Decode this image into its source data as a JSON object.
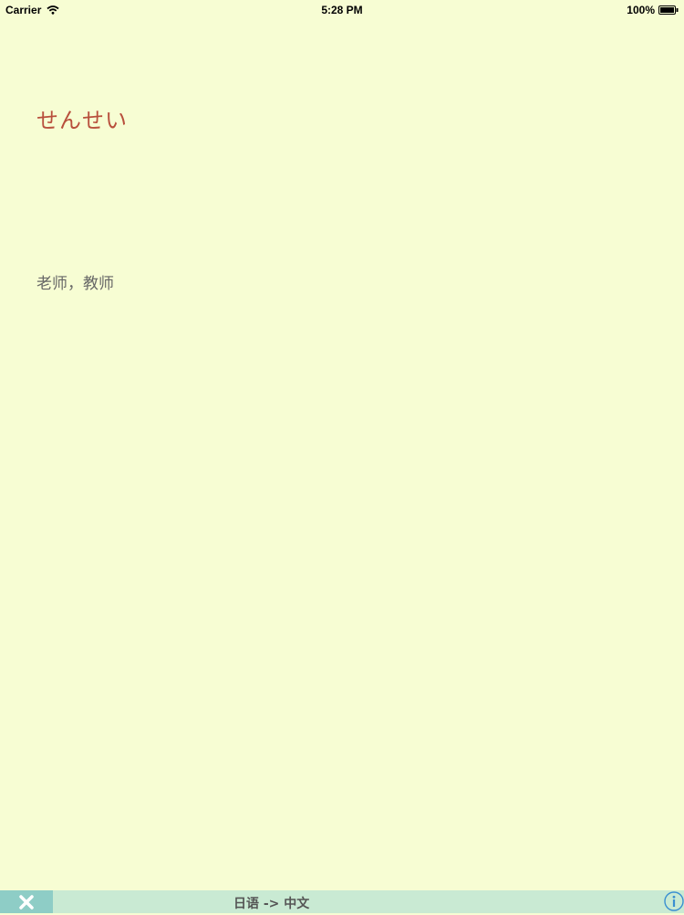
{
  "status_bar": {
    "carrier": "Carrier",
    "time": "5:28 PM",
    "battery": "100%"
  },
  "card": {
    "word": "せんせい",
    "meaning": "老师，教师"
  },
  "bottom_bar": {
    "direction": "日语 -> 中文",
    "close_icon": "close-icon",
    "info_icon": "info-icon"
  },
  "colors": {
    "background": "#f7fdd3",
    "word": "#b84f3c",
    "meaning": "#666666",
    "bottom_bar": "#c9ead3",
    "close_button": "#8ecdc6",
    "info_icon": "#3a8fd1"
  }
}
